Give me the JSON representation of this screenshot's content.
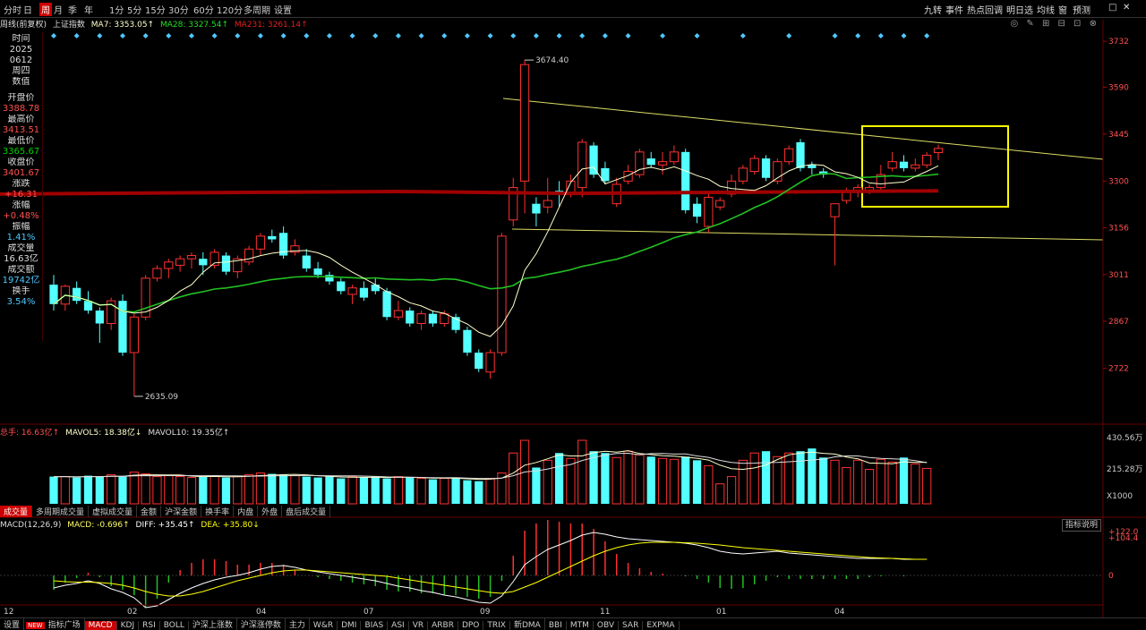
{
  "top_bar": {
    "periods": [
      "分时",
      "日",
      "周",
      "月",
      "季",
      "年",
      "1分",
      "5分",
      "15分",
      "30分",
      "60分",
      "120分",
      "多周期",
      "设置"
    ],
    "active_period": "周",
    "right_tabs": [
      "九转",
      "事件",
      "热点回调",
      "明日选",
      "均线",
      "窗",
      "预测"
    ],
    "window_controls": [
      "□",
      "✕"
    ]
  },
  "info_bar": {
    "period_label": "周线(前复权)",
    "index_name": "上证指数",
    "ma7": "MA7: 3353.05↑",
    "ma28": "MA28: 3327.54↑",
    "ma231": "MA231: 3261.14↑"
  },
  "left_panel": {
    "time_label": "时间",
    "year": "2025",
    "date": "0612",
    "weekday": "周四",
    "value_label": "数值",
    "open_label": "开盘价",
    "open": "3388.78",
    "high_label": "最高价",
    "high": "3413.51",
    "low_label": "最低价",
    "low": "3365.67",
    "close_label": "收盘价",
    "close": "3401.67",
    "change_label": "涨跌",
    "change": "+16.31",
    "pct_label": "涨幅",
    "pct": "+0.48%",
    "amp_label": "振幅",
    "amp": "1.41%",
    "volume_label": "成交量",
    "volume": "16.63亿",
    "amount_label": "成交额",
    "amount": "19742亿",
    "turnover_label": "换手",
    "turnover": "3.54%"
  },
  "price_axis": [
    "3732",
    "3590",
    "3445",
    "3300",
    "3156",
    "3011",
    "2867",
    "2722"
  ],
  "annotations": {
    "high_mark": "3674.40",
    "low_mark": "2635.09"
  },
  "volume_bar": {
    "total": "总手: 16.63亿↑",
    "mavol5": "MAVOL5: 18.38亿↓",
    "mavol10": "MAVOL10: 19.35亿↑"
  },
  "volume_axis": [
    "430.56万",
    "215.28万",
    "X1000"
  ],
  "volume_tabs": [
    "成交量",
    "多周期成交量",
    "虚拟成交量",
    "金额",
    "沪深金额",
    "换手率",
    "内盘",
    "外盘",
    "盘后成交量"
  ],
  "macd_bar": {
    "name": "MACD(12,26,9)",
    "macd": "MACD: -0.696↑",
    "diff": "DIFF: +35.45↑",
    "dea": "DEA: +35.80↓"
  },
  "macd_axis": [
    "+122.0",
    "+104.4",
    "0"
  ],
  "indicator_button": "指标说明",
  "x_axis": [
    "12",
    "02",
    "04",
    "07",
    "09",
    "11",
    "01",
    "04"
  ],
  "bottom_tabs": [
    "设置",
    "NEW",
    "指标广场",
    "MACD",
    "KDJ",
    "RSI",
    "BOLL",
    "沪深上涨数",
    "沪深涨停数",
    "主力",
    "W&R",
    "DMI",
    "BIAS",
    "ASI",
    "VR",
    "ARBR",
    "DPO",
    "TRIX",
    "新DMA",
    "BBI",
    "MTM",
    "OBV",
    "SAR",
    "EXPMA"
  ],
  "active_bottom_tab": "MACD",
  "colors": {
    "up": "#ff3030",
    "down": "#54ffff",
    "ma7": "#ffffcc",
    "ma28": "#22c022",
    "ma231": "#a00000",
    "highlight": "#ffff00"
  },
  "chart_data": {
    "type": "candlestick",
    "title": "上证指数",
    "ylim": [
      2560,
      3760
    ],
    "candles": [
      {
        "o": 2980,
        "h": 3010,
        "l": 2900,
        "c": 2920
      },
      {
        "o": 2920,
        "h": 2980,
        "l": 2900,
        "c": 2975
      },
      {
        "o": 2970,
        "h": 2990,
        "l": 2920,
        "c": 2930
      },
      {
        "o": 2930,
        "h": 2960,
        "l": 2890,
        "c": 2900
      },
      {
        "o": 2900,
        "h": 2910,
        "l": 2800,
        "c": 2860
      },
      {
        "o": 2860,
        "h": 2940,
        "l": 2840,
        "c": 2930
      },
      {
        "o": 2930,
        "h": 2950,
        "l": 2760,
        "c": 2770
      },
      {
        "o": 2770,
        "h": 2890,
        "l": 2635,
        "c": 2880
      },
      {
        "o": 2880,
        "h": 3010,
        "l": 2870,
        "c": 3000
      },
      {
        "o": 3000,
        "h": 3040,
        "l": 2990,
        "c": 3030
      },
      {
        "o": 3030,
        "h": 3060,
        "l": 3000,
        "c": 3050
      },
      {
        "o": 3040,
        "h": 3070,
        "l": 3020,
        "c": 3060
      },
      {
        "o": 3060,
        "h": 3080,
        "l": 3030,
        "c": 3070
      },
      {
        "o": 3060,
        "h": 3080,
        "l": 3010,
        "c": 3040
      },
      {
        "o": 3040,
        "h": 3090,
        "l": 3030,
        "c": 3080
      },
      {
        "o": 3070,
        "h": 3080,
        "l": 3010,
        "c": 3020
      },
      {
        "o": 3020,
        "h": 3070,
        "l": 3000,
        "c": 3060
      },
      {
        "o": 3050,
        "h": 3100,
        "l": 3040,
        "c": 3090
      },
      {
        "o": 3090,
        "h": 3140,
        "l": 3070,
        "c": 3130
      },
      {
        "o": 3130,
        "h": 3150,
        "l": 3110,
        "c": 3120
      },
      {
        "o": 3140,
        "h": 3160,
        "l": 3060,
        "c": 3070
      },
      {
        "o": 3080,
        "h": 3120,
        "l": 3070,
        "c": 3100
      },
      {
        "o": 3070,
        "h": 3090,
        "l": 3020,
        "c": 3030
      },
      {
        "o": 3030,
        "h": 3050,
        "l": 3000,
        "c": 3010
      },
      {
        "o": 3010,
        "h": 3020,
        "l": 2980,
        "c": 2990
      },
      {
        "o": 2990,
        "h": 3000,
        "l": 2950,
        "c": 2960
      },
      {
        "o": 2950,
        "h": 2980,
        "l": 2920,
        "c": 2970
      },
      {
        "o": 2970,
        "h": 2990,
        "l": 2930,
        "c": 2940
      },
      {
        "o": 2980,
        "h": 3000,
        "l": 2950,
        "c": 2960
      },
      {
        "o": 2960,
        "h": 2970,
        "l": 2870,
        "c": 2880
      },
      {
        "o": 2880,
        "h": 2930,
        "l": 2870,
        "c": 2900
      },
      {
        "o": 2900,
        "h": 2910,
        "l": 2850,
        "c": 2860
      },
      {
        "o": 2860,
        "h": 2900,
        "l": 2840,
        "c": 2890
      },
      {
        "o": 2890,
        "h": 2900,
        "l": 2850,
        "c": 2860
      },
      {
        "o": 2860,
        "h": 2900,
        "l": 2850,
        "c": 2890
      },
      {
        "o": 2880,
        "h": 2890,
        "l": 2830,
        "c": 2840
      },
      {
        "o": 2840,
        "h": 2850,
        "l": 2760,
        "c": 2770
      },
      {
        "o": 2770,
        "h": 2780,
        "l": 2710,
        "c": 2720
      },
      {
        "o": 2710,
        "h": 2780,
        "l": 2690,
        "c": 2770
      },
      {
        "o": 2770,
        "h": 3140,
        "l": 2760,
        "c": 3130
      },
      {
        "o": 3180,
        "h": 3310,
        "l": 3160,
        "c": 3280
      },
      {
        "o": 3300,
        "h": 3674,
        "l": 3200,
        "c": 3660
      },
      {
        "o": 3230,
        "h": 3250,
        "l": 3160,
        "c": 3200
      },
      {
        "o": 3220,
        "h": 3310,
        "l": 3200,
        "c": 3240
      },
      {
        "o": 3270,
        "h": 3300,
        "l": 3220,
        "c": 3260
      },
      {
        "o": 3260,
        "h": 3320,
        "l": 3250,
        "c": 3300
      },
      {
        "o": 3280,
        "h": 3430,
        "l": 3250,
        "c": 3420
      },
      {
        "o": 3410,
        "h": 3420,
        "l": 3310,
        "c": 3320
      },
      {
        "o": 3340,
        "h": 3360,
        "l": 3290,
        "c": 3300
      },
      {
        "o": 3230,
        "h": 3310,
        "l": 3220,
        "c": 3290
      },
      {
        "o": 3300,
        "h": 3350,
        "l": 3290,
        "c": 3330
      },
      {
        "o": 3320,
        "h": 3400,
        "l": 3310,
        "c": 3390
      },
      {
        "o": 3370,
        "h": 3390,
        "l": 3340,
        "c": 3350
      },
      {
        "o": 3350,
        "h": 3390,
        "l": 3320,
        "c": 3360
      },
      {
        "o": 3360,
        "h": 3410,
        "l": 3350,
        "c": 3390
      },
      {
        "o": 3390,
        "h": 3400,
        "l": 3200,
        "c": 3210
      },
      {
        "o": 3230,
        "h": 3250,
        "l": 3170,
        "c": 3190
      },
      {
        "o": 3160,
        "h": 3260,
        "l": 3140,
        "c": 3250
      },
      {
        "o": 3220,
        "h": 3250,
        "l": 3210,
        "c": 3240
      },
      {
        "o": 3260,
        "h": 3320,
        "l": 3250,
        "c": 3300
      },
      {
        "o": 3300,
        "h": 3350,
        "l": 3290,
        "c": 3340
      },
      {
        "o": 3330,
        "h": 3380,
        "l": 3320,
        "c": 3370
      },
      {
        "o": 3370,
        "h": 3380,
        "l": 3300,
        "c": 3310
      },
      {
        "o": 3300,
        "h": 3370,
        "l": 3290,
        "c": 3360
      },
      {
        "o": 3360,
        "h": 3410,
        "l": 3350,
        "c": 3400
      },
      {
        "o": 3420,
        "h": 3430,
        "l": 3330,
        "c": 3340
      },
      {
        "o": 3350,
        "h": 3360,
        "l": 3320,
        "c": 3340
      },
      {
        "o": 3330,
        "h": 3340,
        "l": 3310,
        "c": 3320
      },
      {
        "o": 3190,
        "h": 3220,
        "l": 3040,
        "c": 3230
      },
      {
        "o": 3240,
        "h": 3280,
        "l": 3230,
        "c": 3270
      },
      {
        "o": 3270,
        "h": 3290,
        "l": 3250,
        "c": 3280
      },
      {
        "o": 3270,
        "h": 3290,
        "l": 3260,
        "c": 3280
      },
      {
        "o": 3280,
        "h": 3350,
        "l": 3270,
        "c": 3320
      },
      {
        "o": 3340,
        "h": 3390,
        "l": 3330,
        "c": 3360
      },
      {
        "o": 3360,
        "h": 3380,
        "l": 3330,
        "c": 3340
      },
      {
        "o": 3340,
        "h": 3370,
        "l": 3330,
        "c": 3350
      },
      {
        "o": 3350,
        "h": 3390,
        "l": 3340,
        "c": 3380
      },
      {
        "o": 3388,
        "h": 3413,
        "l": 3365,
        "c": 3401
      }
    ],
    "volume": [
      300,
      300,
      290,
      310,
      300,
      320,
      300,
      350,
      330,
      300,
      310,
      300,
      290,
      300,
      310,
      290,
      300,
      320,
      340,
      330,
      320,
      310,
      300,
      290,
      300,
      280,
      300,
      290,
      300,
      280,
      300,
      290,
      280,
      270,
      280,
      290,
      260,
      250,
      280,
      340,
      560,
      700,
      400,
      480,
      560,
      500,
      700,
      580,
      560,
      510,
      580,
      540,
      520,
      500,
      490,
      520,
      480,
      420,
      220,
      300,
      480,
      560,
      580,
      520,
      560,
      580,
      610,
      510,
      480,
      400,
      480,
      380,
      490,
      460,
      510,
      440,
      390
    ],
    "macd_diff": [
      -28,
      -22,
      -18,
      -12,
      -18,
      -30,
      -38,
      -50,
      -72,
      -68,
      -54,
      -40,
      -28,
      -18,
      -10,
      -4,
      0,
      6,
      14,
      20,
      22,
      18,
      12,
      8,
      4,
      0,
      -4,
      -8,
      -12,
      -18,
      -24,
      -28,
      -34,
      -38,
      -44,
      -48,
      -54,
      -60,
      -62,
      -46,
      -14,
      24,
      42,
      58,
      68,
      78,
      90,
      96,
      92,
      86,
      82,
      80,
      78,
      76,
      74,
      72,
      68,
      62,
      54,
      50,
      48,
      50,
      52,
      54,
      50,
      48,
      46,
      44,
      42,
      40,
      38,
      38,
      38,
      38,
      36,
      36,
      36
    ],
    "macd_dea": [
      -12,
      -14,
      -15,
      -15,
      -16,
      -18,
      -22,
      -28,
      -36,
      -42,
      -46,
      -46,
      -42,
      -36,
      -28,
      -20,
      -12,
      -6,
      0,
      6,
      10,
      12,
      12,
      10,
      8,
      6,
      4,
      2,
      0,
      -2,
      -6,
      -10,
      -14,
      -18,
      -22,
      -26,
      -30,
      -34,
      -38,
      -40,
      -36,
      -26,
      -16,
      -4,
      8,
      20,
      32,
      44,
      54,
      62,
      68,
      72,
      74,
      74,
      74,
      73,
      72,
      70,
      68,
      65,
      62,
      60,
      58,
      56,
      54,
      52,
      50,
      48,
      46,
      44,
      42,
      40,
      39,
      38,
      37,
      36,
      36
    ]
  }
}
